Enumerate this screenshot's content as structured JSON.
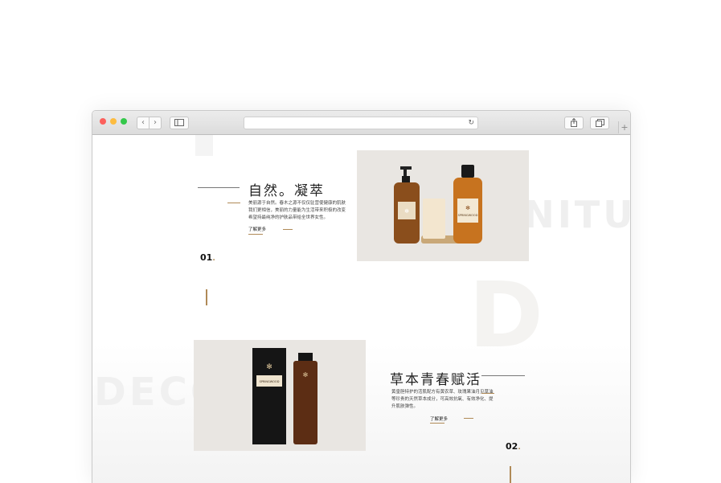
{
  "browser": {
    "back_icon": "chevron-left",
    "forward_icon": "chevron-right",
    "reload_icon": "reload",
    "new_tab_icon": "plus",
    "back": "‹",
    "forward": "›",
    "reload": "↻",
    "new_tab": "+"
  },
  "background": {
    "word1": "FURNITU",
    "word2": "D",
    "word3": "DECOR"
  },
  "section1": {
    "title": "自然。凝萃",
    "description": "美丽源于自然。春木之源不仅仅驻营使健康的肌肤我们更相信，美丽的力量能为生活带来积极的改变希望持最纯净的护肤品带给全世界女性。",
    "more_label": "了解更多",
    "number": "01",
    "number_dot": "."
  },
  "section2": {
    "title": "草本青春赋活",
    "description": "黄皇胆特护的活肌配方有黄农草、玫瑰果油月见草油等珍贵的天然草本成分，可高效抗氧、有效净化、提升肌肤弹性。",
    "more_label": "了解更多",
    "number": "02",
    "number_dot": "."
  },
  "products": {
    "bottle_brand": "SPRINGWOOD",
    "box_brand": "SPRINGWOOD"
  },
  "colors": {
    "accent": "#b08a57",
    "image_bg": "#e9e6e2",
    "amber": "#b06a1e"
  }
}
